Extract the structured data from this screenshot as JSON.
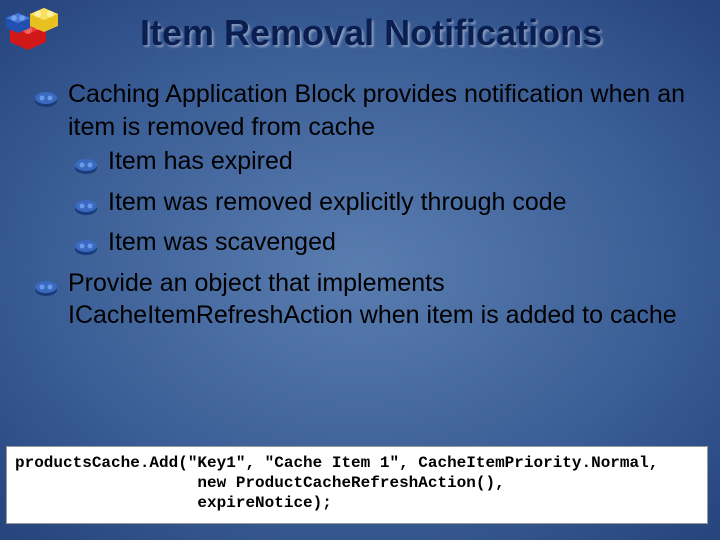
{
  "title": "Item Removal Notifications",
  "bullets": {
    "l1_a": "Caching Application Block provides notification when an item is removed from cache",
    "l2_a": "Item has expired",
    "l2_b": "Item was removed explicitly through code",
    "l2_c": "Item was scavenged",
    "l1_b": "Provide an object that implements ICacheItemRefreshAction when item is added to cache"
  },
  "code": {
    "line1": "productsCache.Add(\"Key1\", \"Cache Item 1\", CacheItemPriority.Normal,",
    "line2": "                   new ProductCacheRefreshAction(),",
    "line3": "                   expireNotice);"
  }
}
